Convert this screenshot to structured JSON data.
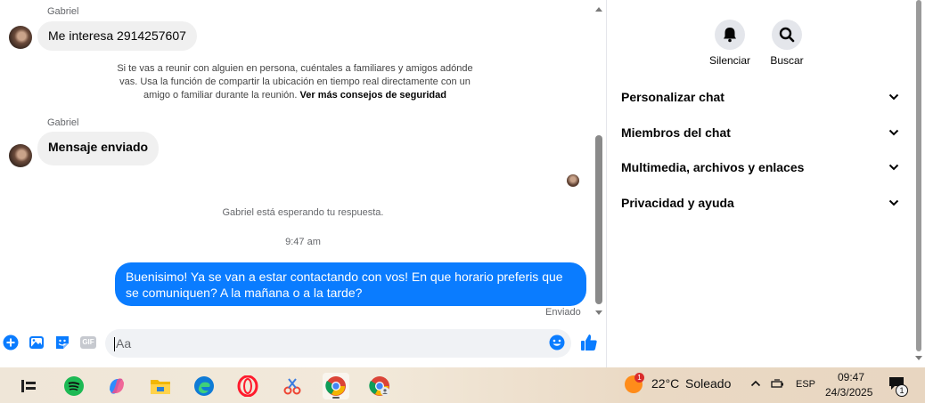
{
  "chat": {
    "messages": [
      {
        "sender": "Gabriel",
        "text": "Me interesa 2914257607"
      },
      {
        "sender": "Gabriel",
        "text": "Mensaje enviado"
      }
    ],
    "safety_notice": "Si te vas a reunir con alguien en persona, cuéntales a familiares y amigos adónde vas. Usa la función de compartir la ubicación en tiempo real directamente con un amigo o familiar durante la reunión.",
    "safety_link": "Ver más consejos de seguridad",
    "waiting_note": "Gabriel está esperando tu respuesta.",
    "timestamp": "9:47 am",
    "outgoing_message": "Buenisimo! Ya se van a estar contactando con vos! En que horario preferis que se comuniquen? A la mañana o a la tarde?",
    "status": "Enviado"
  },
  "composer": {
    "placeholder": "Aa",
    "gif_label": "GIF"
  },
  "panel": {
    "actions": [
      {
        "label": "Silenciar",
        "icon": "bell-icon"
      },
      {
        "label": "Buscar",
        "icon": "search-icon"
      }
    ],
    "sections": [
      "Personalizar chat",
      "Miembros del chat",
      "Multimedia, archivos y enlaces",
      "Privacidad y ayuda"
    ]
  },
  "taskbar": {
    "apps": [
      "task-view-icon",
      "spotify-icon",
      "copilot-icon",
      "file-explorer-icon",
      "edge-icon",
      "opera-icon",
      "snipping-icon",
      "chrome-icon",
      "chrome-profile-icon"
    ],
    "weather": {
      "badge": "1",
      "temperature": "22°C",
      "condition": "Soleado"
    },
    "language": "ESP",
    "time": "09:47",
    "date": "24/3/2025",
    "notification_count": "1"
  },
  "colors": {
    "accent": "#0a7cff",
    "bubble_in": "#f0f0f0",
    "muted_text": "#65676b"
  }
}
